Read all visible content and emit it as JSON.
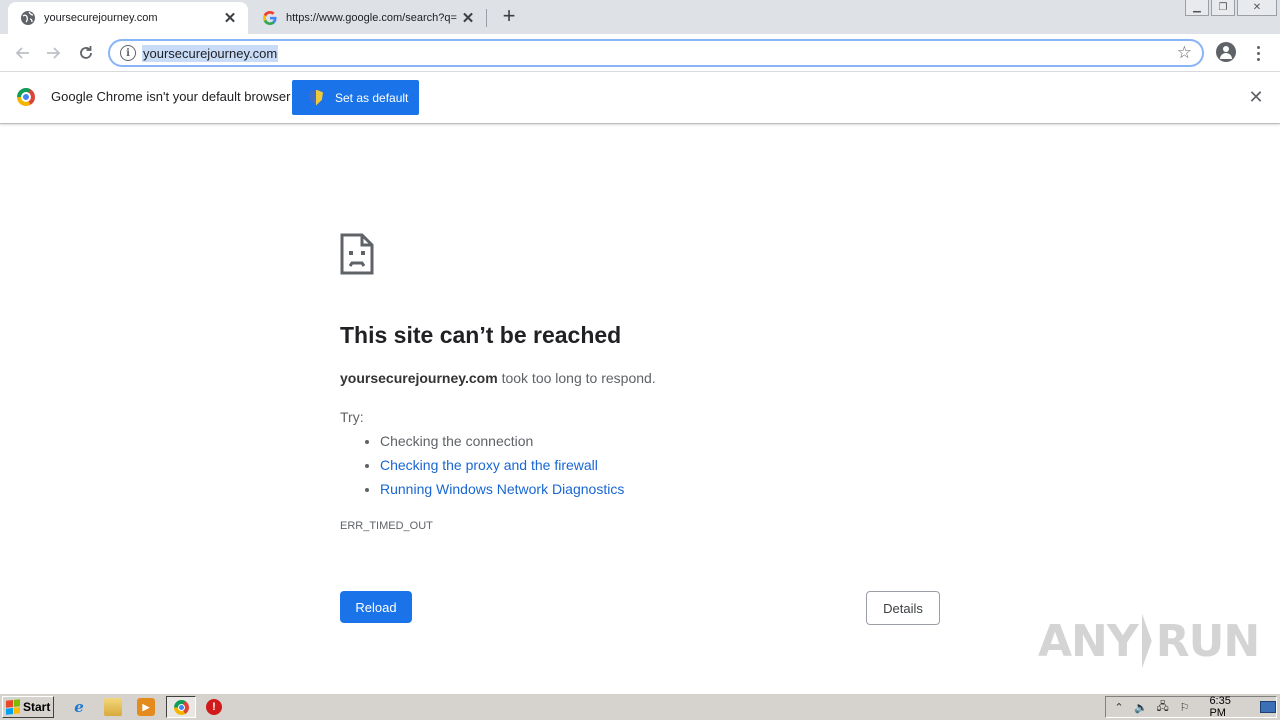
{
  "browser": {
    "tabs": [
      {
        "title": "yoursecurejourney.com",
        "favicon": "globe-icon",
        "active": true
      },
      {
        "title": "https://www.google.com/search?q=",
        "favicon": "google-g-icon",
        "active": false
      }
    ],
    "address_bar": {
      "url": "yoursecurejourney.com"
    },
    "infobar": {
      "message": "Google Chrome isn't your default browser",
      "button_label": "Set as default"
    }
  },
  "error_page": {
    "title": "This site can’t be reached",
    "host": "yoursecurejourney.com",
    "message_suffix": "took too long to respond.",
    "try_label": "Try:",
    "suggestions": [
      {
        "text": "Checking the connection",
        "is_link": false
      },
      {
        "text": "Checking the proxy and the firewall",
        "is_link": true
      },
      {
        "text": "Running Windows Network Diagnostics",
        "is_link": true
      }
    ],
    "error_code": "ERR_TIMED_OUT",
    "reload_label": "Reload",
    "details_label": "Details"
  },
  "watermark": {
    "left": "ANY",
    "right": "RUN"
  },
  "taskbar": {
    "start_label": "Start",
    "clock": "6:35 PM"
  },
  "colors": {
    "accent": "#1a73e8",
    "link": "#1967d2",
    "tabstrip": "#dee1e6"
  }
}
